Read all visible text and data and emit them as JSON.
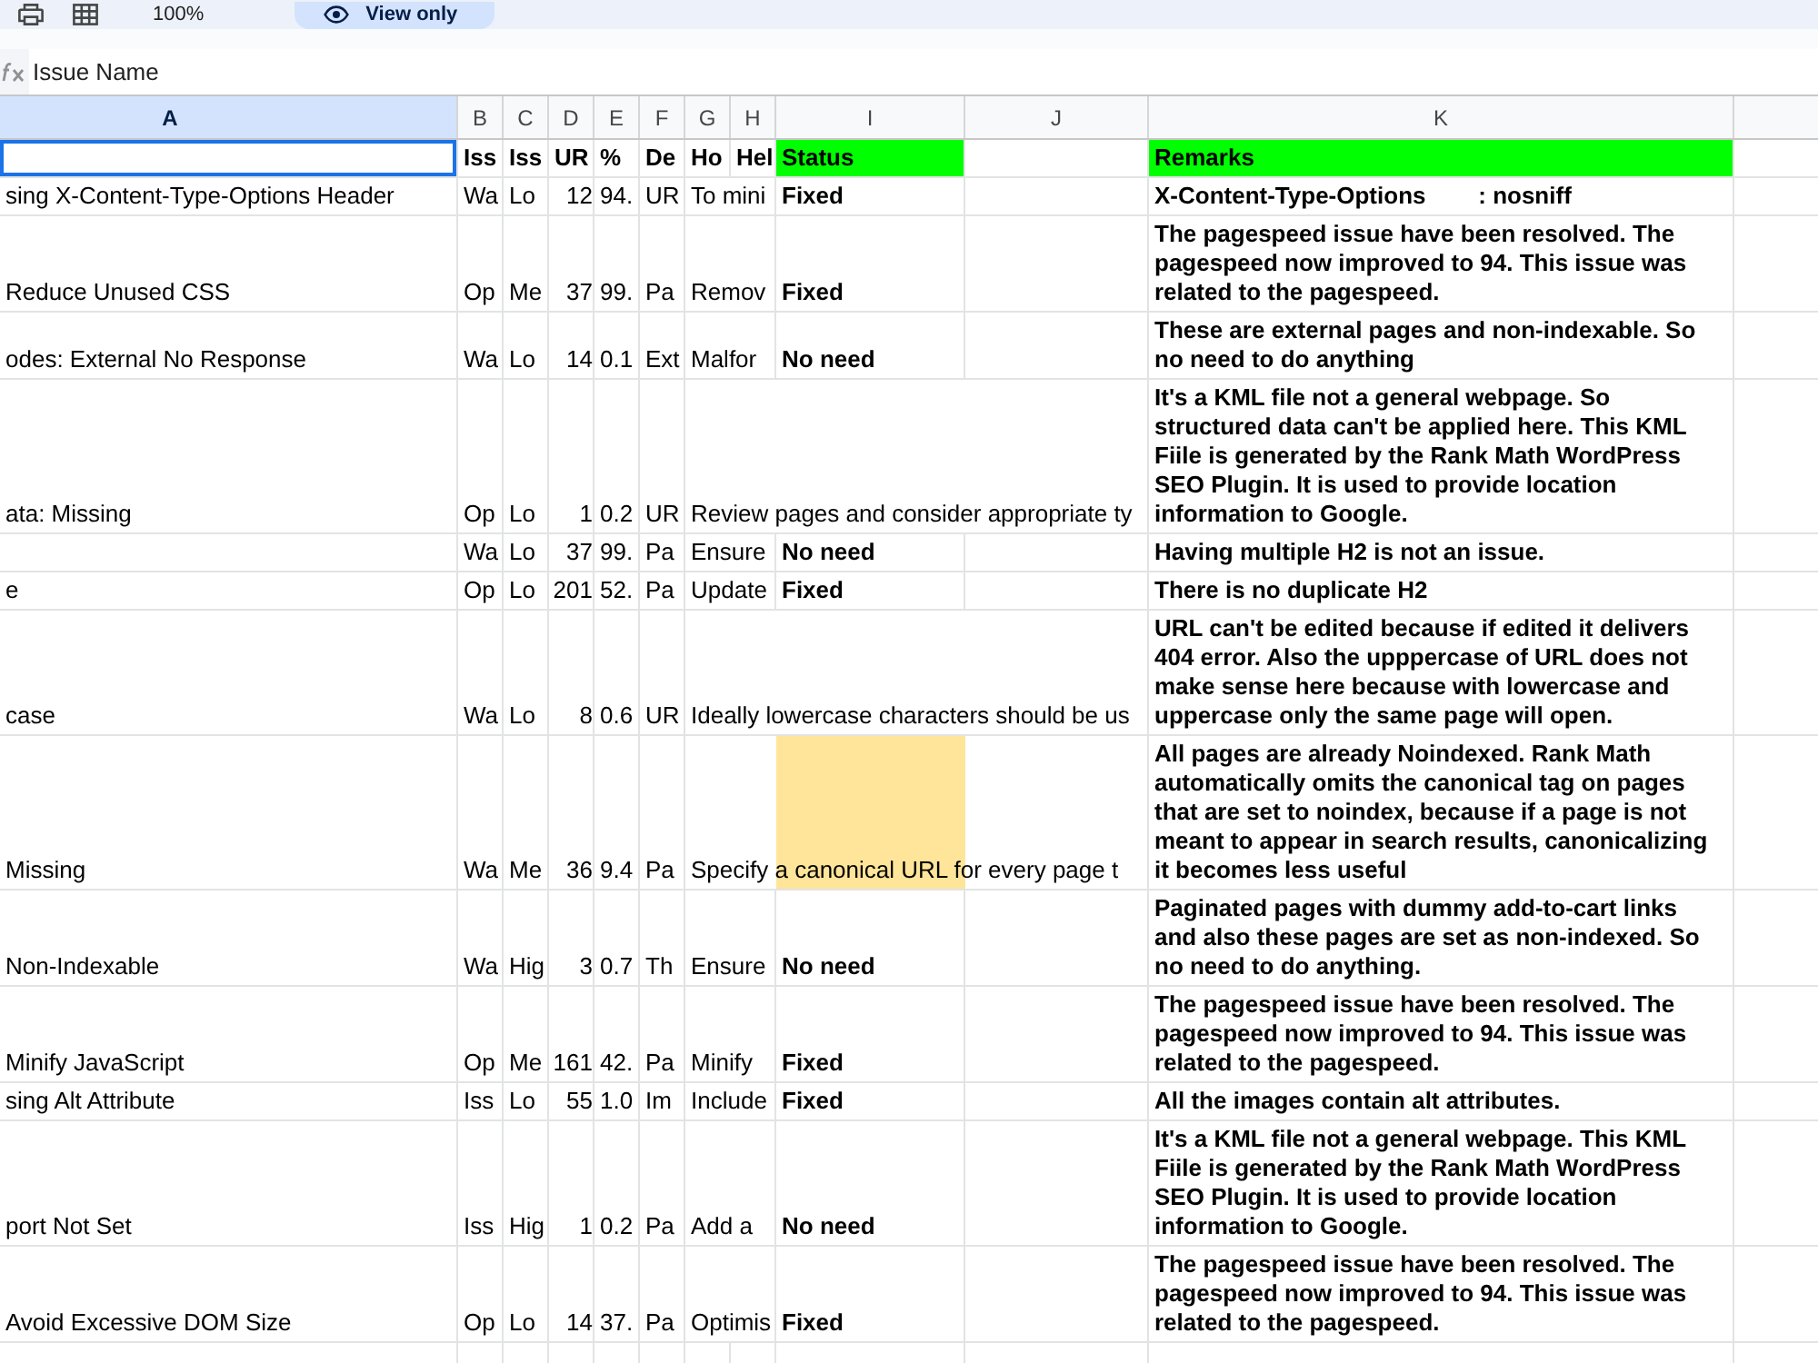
{
  "toolbar": {
    "zoom": "100%",
    "mode_button": "View only"
  },
  "formula_bar": {
    "value": "Issue Name"
  },
  "sheet": {
    "columns": [
      {
        "label": "A",
        "selected": true,
        "kind": "text"
      },
      {
        "label": "B",
        "selected": false,
        "kind": "text"
      },
      {
        "label": "C",
        "selected": false,
        "kind": "text"
      },
      {
        "label": "D",
        "selected": false,
        "kind": "number"
      },
      {
        "label": "E",
        "selected": false,
        "kind": "text"
      },
      {
        "label": "F",
        "selected": false,
        "kind": "text"
      },
      {
        "label": "G",
        "selected": false,
        "kind": "text"
      },
      {
        "label": "H",
        "selected": false,
        "kind": "text"
      },
      {
        "label": "I",
        "selected": false,
        "kind": "status"
      },
      {
        "label": "J",
        "selected": false,
        "kind": "text"
      },
      {
        "label": "K",
        "selected": false,
        "kind": "note"
      }
    ],
    "rows": [
      {
        "kind": "header",
        "selected": true,
        "cells": {
          "B": {
            "text": "Iss"
          },
          "C": {
            "text": "Iss"
          },
          "D": {
            "text": "UR"
          },
          "E": {
            "text": "%"
          },
          "F": {
            "text": "De"
          },
          "G": {
            "text": "Ho"
          },
          "H": {
            "text": "Hel"
          },
          "I": {
            "text": "Status",
            "color": "#00ff00"
          },
          "K": {
            "text": "Remarks",
            "color": "#00ff00"
          }
        }
      },
      {
        "kind": "data",
        "selected": false,
        "cells": {
          "A": {
            "text": "sing X-Content-Type-Options Header"
          },
          "B": {
            "text": "Wa"
          },
          "C": {
            "text": "Lo"
          },
          "D": {
            "text": "12"
          },
          "E": {
            "text": "94."
          },
          "F": {
            "text": "UR"
          },
          "G": {
            "text": "To mini"
          },
          "I": {
            "text": "Fixed"
          },
          "K": {
            "text": "X-Content-Type-Options        : nosniff"
          }
        }
      },
      {
        "kind": "data",
        "selected": false,
        "cells": {
          "A": {
            "text": "Reduce Unused CSS"
          },
          "B": {
            "text": "Op"
          },
          "C": {
            "text": "Me"
          },
          "D": {
            "text": "37"
          },
          "E": {
            "text": "99."
          },
          "F": {
            "text": "Pa"
          },
          "G": {
            "text": "Remov"
          },
          "I": {
            "text": "Fixed"
          },
          "K": {
            "text": "The pagespeed issue have been resolved. The pagespeed now improved to 94. This issue was related to the pagespeed."
          }
        }
      },
      {
        "kind": "data",
        "selected": false,
        "cells": {
          "A": {
            "text": "odes: External No Response"
          },
          "B": {
            "text": "Wa"
          },
          "C": {
            "text": "Lo"
          },
          "D": {
            "text": "14"
          },
          "E": {
            "text": "0.1"
          },
          "F": {
            "text": "Ext"
          },
          "G": {
            "text": "Malfor"
          },
          "I": {
            "text": "No need"
          },
          "K": {
            "text": "These are external pages and non-indexable. So no need to do anything"
          }
        }
      },
      {
        "kind": "data",
        "selected": false,
        "cells": {
          "A": {
            "text": "ata: Missing"
          },
          "B": {
            "text": "Op"
          },
          "C": {
            "text": "Lo"
          },
          "D": {
            "text": "1"
          },
          "E": {
            "text": "0.2"
          },
          "F": {
            "text": "UR"
          },
          "G": {
            "text": "Review pages and consider appropriate ty"
          },
          "K": {
            "text": "It's a KML file not a general webpage. So structured data can't be applied here. This KML Fiile is generated by the Rank Math WordPress SEO Plugin. It is used to provide location information to Google."
          }
        }
      },
      {
        "kind": "data",
        "selected": false,
        "cells": {
          "B": {
            "text": "Wa"
          },
          "C": {
            "text": "Lo"
          },
          "D": {
            "text": "37"
          },
          "E": {
            "text": "99."
          },
          "F": {
            "text": "Pa"
          },
          "G": {
            "text": "Ensure"
          },
          "I": {
            "text": "No need"
          },
          "K": {
            "text": "Having multiple H2 is not an issue."
          }
        }
      },
      {
        "kind": "data",
        "selected": false,
        "cells": {
          "A": {
            "text": "e"
          },
          "B": {
            "text": "Op"
          },
          "C": {
            "text": "Lo"
          },
          "D": {
            "text": "201"
          },
          "E": {
            "text": "52."
          },
          "F": {
            "text": "Pa"
          },
          "G": {
            "text": "Update"
          },
          "I": {
            "text": "Fixed"
          },
          "K": {
            "text": "There is no duplicate H2"
          }
        }
      },
      {
        "kind": "data",
        "selected": false,
        "cells": {
          "A": {
            "text": "case"
          },
          "B": {
            "text": "Wa"
          },
          "C": {
            "text": "Lo"
          },
          "D": {
            "text": "8"
          },
          "E": {
            "text": "0.6"
          },
          "F": {
            "text": "UR"
          },
          "G": {
            "text": "Ideally lowercase characters should be us"
          },
          "K": {
            "text": "URL can't be edited because if edited it delivers 404 error. Also the upppercase of URL does not make sense here because with lowercase and uppercase only the same page will open."
          }
        }
      },
      {
        "kind": "data",
        "selected": false,
        "cells": {
          "A": {
            "text": "Missing"
          },
          "B": {
            "text": "Wa"
          },
          "C": {
            "text": "Me"
          },
          "D": {
            "text": "36"
          },
          "E": {
            "text": "9.4"
          },
          "F": {
            "text": "Pa"
          },
          "G": {
            "text": "Specify a canonical URL for every page t"
          },
          "I": {
            "color": "#ffe599"
          },
          "K": {
            "text": "All pages are already Noindexed. Rank Math automatically omits the canonical tag on pages that are set to noindex, because if a page is not meant to appear in search results, canonicalizing it becomes less useful"
          }
        }
      },
      {
        "kind": "data",
        "selected": false,
        "cells": {
          "A": {
            "text": "Non-Indexable"
          },
          "B": {
            "text": "Wa"
          },
          "C": {
            "text": "Hig"
          },
          "D": {
            "text": "3"
          },
          "E": {
            "text": "0.7"
          },
          "F": {
            "text": "Th"
          },
          "G": {
            "text": "Ensure"
          },
          "I": {
            "text": "No need"
          },
          "K": {
            "text": "Paginated pages with dummy add-to-cart links and also these pages are set as non-indexed. So no need to do anything."
          }
        }
      },
      {
        "kind": "data",
        "selected": false,
        "cells": {
          "A": {
            "text": "Minify JavaScript"
          },
          "B": {
            "text": "Op"
          },
          "C": {
            "text": "Me"
          },
          "D": {
            "text": "161"
          },
          "E": {
            "text": "42."
          },
          "F": {
            "text": "Pa"
          },
          "G": {
            "text": "Minify"
          },
          "I": {
            "text": "Fixed"
          },
          "K": {
            "text": "The pagespeed issue have been resolved. The pagespeed now improved to 94. This issue was related to the pagespeed."
          }
        }
      },
      {
        "kind": "data",
        "selected": false,
        "cells": {
          "A": {
            "text": "sing Alt Attribute"
          },
          "B": {
            "text": "Iss"
          },
          "C": {
            "text": "Lo"
          },
          "D": {
            "text": "55"
          },
          "E": {
            "text": "1.0"
          },
          "F": {
            "text": "Im"
          },
          "G": {
            "text": "Include"
          },
          "I": {
            "text": "Fixed"
          },
          "K": {
            "text": "All the images contain alt attributes."
          }
        }
      },
      {
        "kind": "data",
        "selected": false,
        "cells": {
          "A": {
            "text": "port Not Set"
          },
          "B": {
            "text": "Iss"
          },
          "C": {
            "text": "Hig"
          },
          "D": {
            "text": "1"
          },
          "E": {
            "text": "0.2"
          },
          "F": {
            "text": "Pa"
          },
          "G": {
            "text": "Add a"
          },
          "I": {
            "text": "No need"
          },
          "K": {
            "text": "It's a KML file not a general webpage. This KML Fiile is generated by the Rank Math WordPress SEO Plugin. It is used to provide location information to Google."
          }
        }
      },
      {
        "kind": "data",
        "selected": false,
        "cells": {
          "A": {
            "text": "Avoid Excessive DOM Size"
          },
          "B": {
            "text": "Op"
          },
          "C": {
            "text": "Lo"
          },
          "D": {
            "text": "14"
          },
          "E": {
            "text": "37."
          },
          "F": {
            "text": "Pa"
          },
          "G": {
            "text": "Optimis"
          },
          "I": {
            "text": "Fixed"
          },
          "K": {
            "text": "The pagespeed issue have been resolved. The pagespeed now improved to 94. This issue was related to the pagespeed."
          }
        }
      }
    ]
  }
}
